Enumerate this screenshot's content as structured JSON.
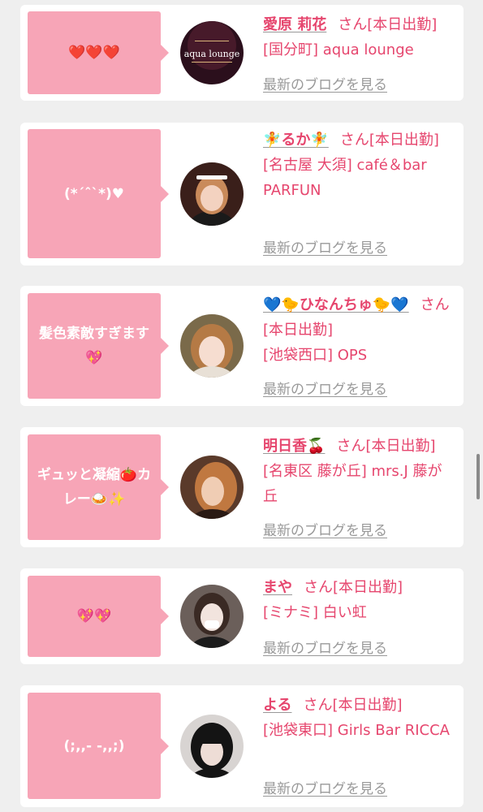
{
  "entries": [
    {
      "comment": "❤️❤️❤️",
      "name": "愛原 莉花",
      "honorific": "さん[本日出勤]",
      "shop": "[国分町] aqua lounge",
      "blog_link": "最新のブログを見る",
      "avatar_logo_text": "aqua lounge"
    },
    {
      "comment": "(*´ˆ`*)♥",
      "name": "🧚るか🧚",
      "honorific": "さん[本日出勤]",
      "shop": "[名古屋 大須] café＆bar PARFUN",
      "blog_link": "最新のブログを見る"
    },
    {
      "comment": "髪色素敵すぎます💖",
      "name": "💙🐤ひなんちゅ🐤💙",
      "honorific": "さん[本日出勤]",
      "shop": "[池袋西口] OPS",
      "blog_link": "最新のブログを見る"
    },
    {
      "comment": "ギュッと凝縮🍅カレー🍛✨",
      "name": "明日香🍒",
      "honorific": "さん[本日出勤]",
      "shop": "[名東区 藤が丘] mrs.J 藤が丘",
      "blog_link": "最新のブログを見る"
    },
    {
      "comment": "💖💖",
      "name": "まや",
      "honorific": "さん[本日出勤]",
      "shop": "[ミナミ] 白い虹",
      "blog_link": "最新のブログを見る"
    },
    {
      "comment": "(;,,- -,,;)",
      "name": "よる",
      "honorific": "さん[本日出勤]",
      "shop": "[池袋東口] Girls Bar RICCA",
      "blog_link": "最新のブログを見る"
    }
  ]
}
